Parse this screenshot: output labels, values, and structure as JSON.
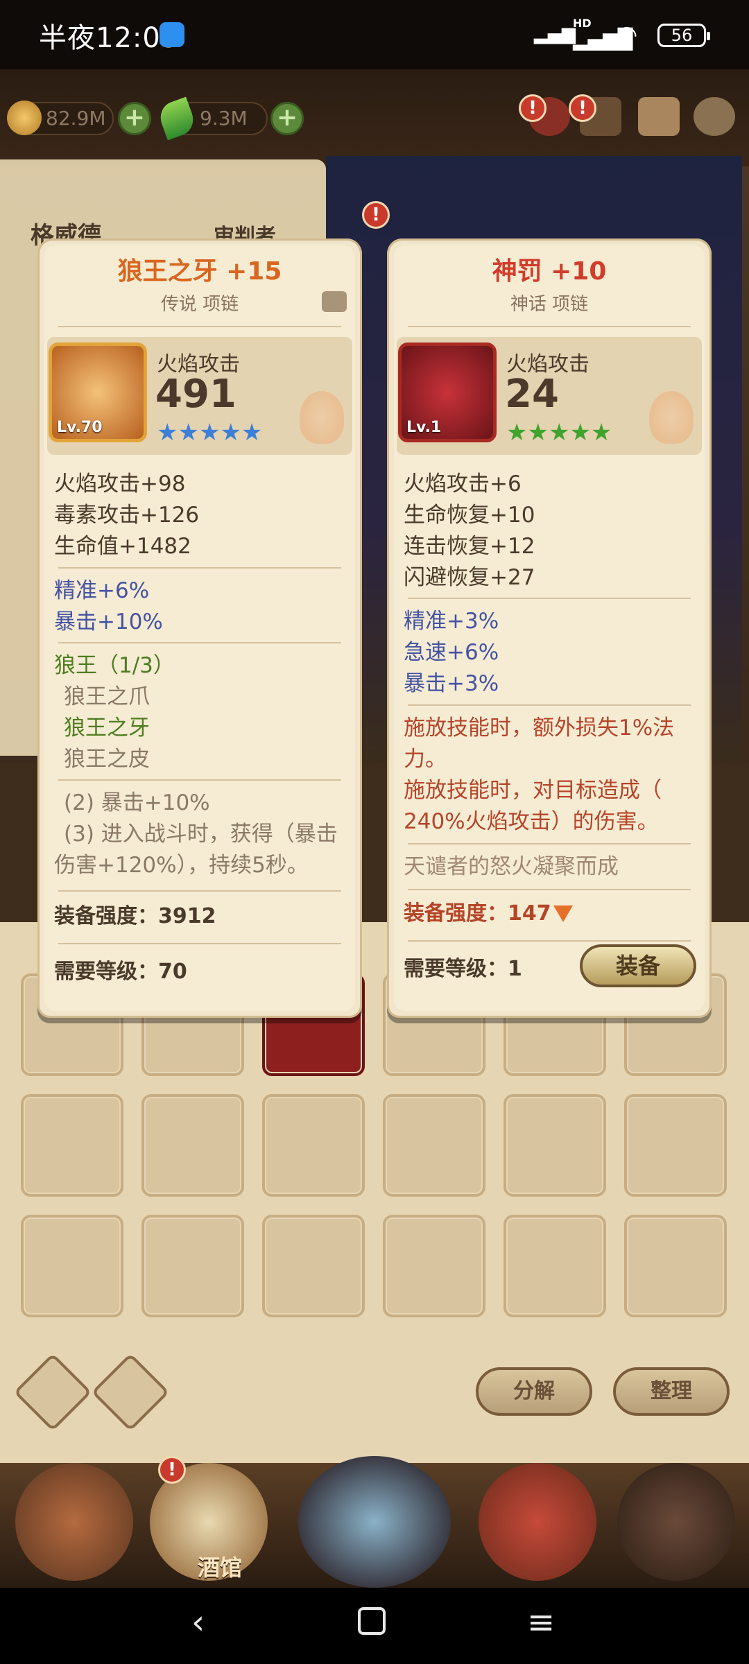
{
  "status_bar": {
    "time": "半夜12:03",
    "battery": "56",
    "network": "HD"
  },
  "top_bar": {
    "gold": "82.9M",
    "gems": "9.3M",
    "alert_mark": "!"
  },
  "background": {
    "name_left": "格威德",
    "name_right": "审判者"
  },
  "bottom_nav": {
    "active_label": "酒馆"
  },
  "bag_buttons": {
    "decompose": "分解",
    "sort": "整理"
  },
  "card_left": {
    "title": "狼王之牙 +15",
    "subtitle": "传说 项链",
    "hero": {
      "stat_label": "火焰攻击",
      "stat_value": "491",
      "level": "Lv.70",
      "stars": "★★★★★"
    },
    "base_stats": [
      "火焰攻击+98",
      "毒素攻击+126",
      "生命值+1482"
    ],
    "sub_stats": [
      "精准+6%",
      "暴击+10%"
    ],
    "set_title": "狼王（1/3）",
    "set_items": [
      "狼王之爪",
      "狼王之牙",
      "狼王之皮"
    ],
    "set_effects": [
      "(2) 暴击+10%",
      "(3) 进入战斗时，获得（暴击",
      "伤害+120%），持续5秒。"
    ],
    "power_label": "装备强度：3912",
    "req_label": "需要等级：70"
  },
  "card_right": {
    "title": "神罚 +10",
    "subtitle": "神话 项链",
    "hero": {
      "stat_label": "火焰攻击",
      "stat_value": "24",
      "level": "Lv.1",
      "stars": "★★★★★"
    },
    "base_stats": [
      "火焰攻击+6",
      "生命恢复+10",
      "连击恢复+12",
      "闪避恢复+27"
    ],
    "sub_stats": [
      "精准+3%",
      "急速+6%",
      "暴击+3%"
    ],
    "effects": [
      "施放技能时，额外损失1%法",
      "力。",
      "施放技能时，对目标造成（",
      "240%火焰攻击）的伤害。"
    ],
    "flavor": "天谴者的怒火凝聚而成",
    "power_label": "装备强度：147",
    "req_label": "需要等级：1",
    "equip_button": "装备"
  },
  "colors": {
    "legend_stars": "#3d7fd6",
    "myth_stars": "#3fa32e",
    "legend_title": "#d9661e",
    "myth_title": "#d23c2a"
  }
}
